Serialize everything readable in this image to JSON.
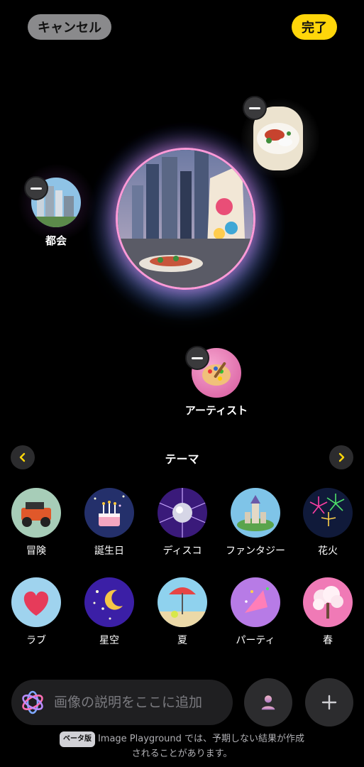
{
  "header": {
    "cancel_label": "キャンセル",
    "done_label": "完了"
  },
  "canvas": {
    "chips": [
      {
        "label": "都会",
        "icon": "city-icon"
      },
      {
        "label": "アーティスト",
        "icon": "palette-icon"
      },
      {
        "label": "",
        "icon": "food-icon"
      }
    ]
  },
  "themes": {
    "title": "テーマ",
    "items": [
      {
        "label": "冒険",
        "icon": "jeep-icon"
      },
      {
        "label": "誕生日",
        "icon": "cake-icon"
      },
      {
        "label": "ディスコ",
        "icon": "disco-ball-icon"
      },
      {
        "label": "ファンタジー",
        "icon": "castle-icon"
      },
      {
        "label": "花火",
        "icon": "fireworks-icon"
      },
      {
        "label": "ラブ",
        "icon": "heart-icon"
      },
      {
        "label": "星空",
        "icon": "moon-stars-icon"
      },
      {
        "label": "夏",
        "icon": "beach-umbrella-icon"
      },
      {
        "label": "パーティ",
        "icon": "party-hat-icon"
      },
      {
        "label": "春",
        "icon": "blossom-tree-icon"
      }
    ]
  },
  "prompt": {
    "placeholder": "画像の説明をここに追加"
  },
  "footer": {
    "beta_badge": "ベータ版",
    "line1": "Image Playground では、予期しない結果が作成",
    "line2": "されることがあります。"
  },
  "colors": {
    "accent": "#ffd60a",
    "cancel_bg": "#8a8a8c",
    "surface": "#2c2c2e"
  }
}
